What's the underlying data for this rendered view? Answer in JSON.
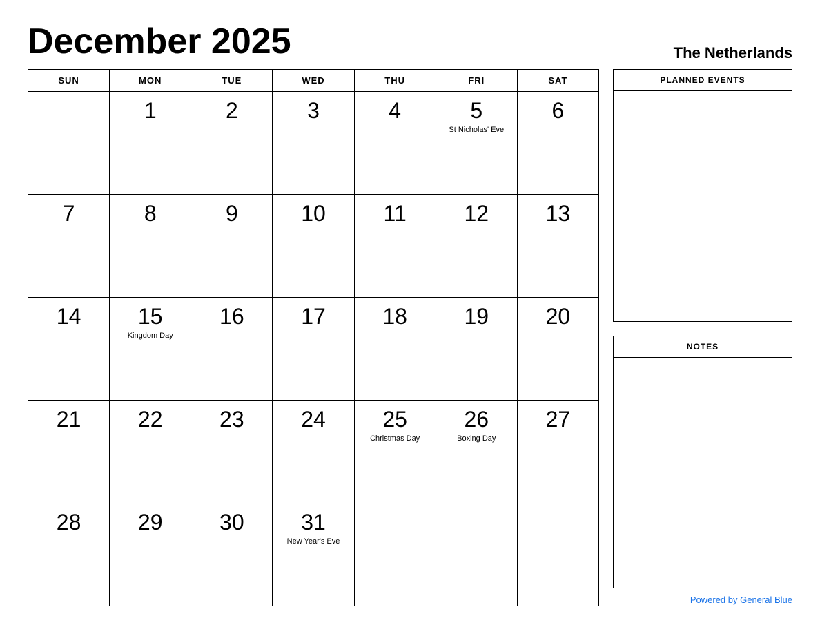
{
  "header": {
    "title": "December 2025",
    "country": "The Netherlands"
  },
  "calendar": {
    "days_of_week": [
      "SUN",
      "MON",
      "TUE",
      "WED",
      "THU",
      "FRI",
      "SAT"
    ],
    "weeks": [
      [
        {
          "day": "",
          "event": ""
        },
        {
          "day": "1",
          "event": ""
        },
        {
          "day": "2",
          "event": ""
        },
        {
          "day": "3",
          "event": ""
        },
        {
          "day": "4",
          "event": ""
        },
        {
          "day": "5",
          "event": "St Nicholas' Eve"
        },
        {
          "day": "6",
          "event": ""
        }
      ],
      [
        {
          "day": "7",
          "event": ""
        },
        {
          "day": "8",
          "event": ""
        },
        {
          "day": "9",
          "event": ""
        },
        {
          "day": "10",
          "event": ""
        },
        {
          "day": "11",
          "event": ""
        },
        {
          "day": "12",
          "event": ""
        },
        {
          "day": "13",
          "event": ""
        }
      ],
      [
        {
          "day": "14",
          "event": ""
        },
        {
          "day": "15",
          "event": "Kingdom Day"
        },
        {
          "day": "16",
          "event": ""
        },
        {
          "day": "17",
          "event": ""
        },
        {
          "day": "18",
          "event": ""
        },
        {
          "day": "19",
          "event": ""
        },
        {
          "day": "20",
          "event": ""
        }
      ],
      [
        {
          "day": "21",
          "event": ""
        },
        {
          "day": "22",
          "event": ""
        },
        {
          "day": "23",
          "event": ""
        },
        {
          "day": "24",
          "event": ""
        },
        {
          "day": "25",
          "event": "Christmas Day"
        },
        {
          "day": "26",
          "event": "Boxing Day"
        },
        {
          "day": "27",
          "event": ""
        }
      ],
      [
        {
          "day": "28",
          "event": ""
        },
        {
          "day": "29",
          "event": ""
        },
        {
          "day": "30",
          "event": ""
        },
        {
          "day": "31",
          "event": "New Year's Eve"
        },
        {
          "day": "",
          "event": ""
        },
        {
          "day": "",
          "event": ""
        },
        {
          "day": "",
          "event": ""
        }
      ]
    ]
  },
  "sidebar": {
    "planned_events_label": "PLANNED EVENTS",
    "notes_label": "NOTES"
  },
  "footer": {
    "powered_by": "Powered by General Blue",
    "link": "#"
  }
}
